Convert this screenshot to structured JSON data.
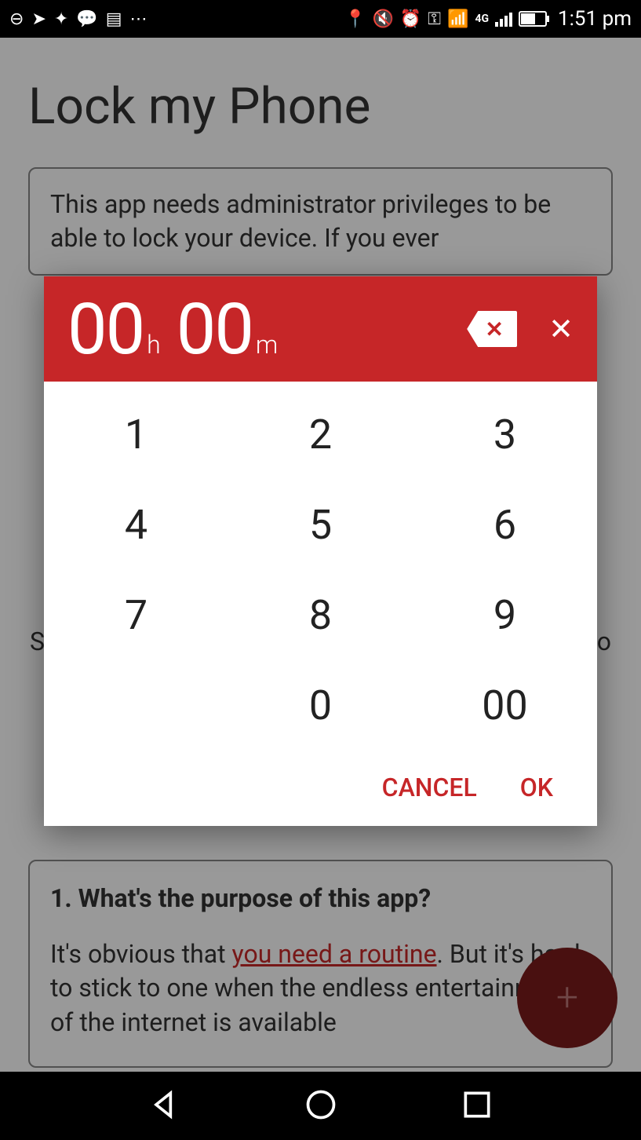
{
  "statusBar": {
    "time": "1:51 pm",
    "networkLabel": "4G"
  },
  "page": {
    "title": "Lock my Phone",
    "adminNotice": "This app needs administrator privileges to be able to lock your device. If you ever",
    "leftHint": "S",
    "rightHint": "o"
  },
  "faq": {
    "title": "1. What's the purpose of this app?",
    "bodyPrefix": "It's obvious that ",
    "link": "you need a routine",
    "bodySuffix": ". But it's hard to stick to one when the endless entertainment of the internet is available"
  },
  "fab": {
    "symbol": "+"
  },
  "dialog": {
    "hours": "00",
    "hoursUnit": "h",
    "minutes": "00",
    "minutesUnit": "m",
    "keypad": [
      "1",
      "2",
      "3",
      "4",
      "5",
      "6",
      "7",
      "8",
      "9",
      "",
      "0",
      "00"
    ],
    "cancelLabel": "CANCEL",
    "okLabel": "OK"
  }
}
